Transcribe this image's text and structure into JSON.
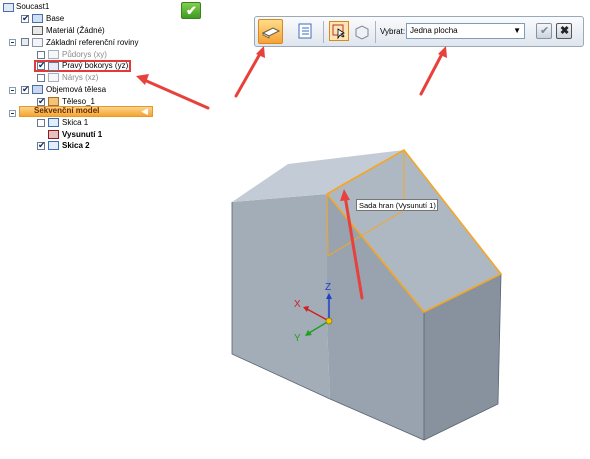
{
  "tree": {
    "root": "Soucast1",
    "items": [
      {
        "label": "Base"
      },
      {
        "label": "Materiál (Žádné)"
      },
      {
        "label": "Základní referenční roviny"
      },
      {
        "label": "Půdorys (xy)"
      },
      {
        "label": "Pravý bokorys (yz)"
      },
      {
        "label": "Nárys (xz)"
      },
      {
        "label": "Objemová tělesa"
      },
      {
        "label": "Těleso_1"
      },
      {
        "label": "Sekvenční model"
      },
      {
        "label": "Skica 1"
      },
      {
        "label": "Vysunutí 1"
      },
      {
        "label": "Skica 2"
      }
    ]
  },
  "toolbar": {
    "select_label": "Vybrat:",
    "select_value": "Jedna plocha"
  },
  "viewport": {
    "tooltip": "Sada hran (Vysunutí 1)",
    "axes": {
      "x": "X",
      "y": "Y",
      "z": "Z"
    }
  },
  "colors": {
    "accent_arrow": "#e8413c",
    "highlight_edge": "#f5a623",
    "model_face": "#a8b2bd",
    "active_group": "#f9b64a"
  }
}
